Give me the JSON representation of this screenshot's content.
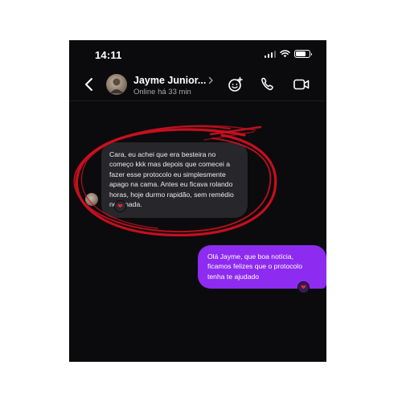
{
  "status_bar": {
    "time": "14:11",
    "icons": [
      "signal-icon",
      "wifi-icon",
      "battery-icon"
    ]
  },
  "header": {
    "back_icon": "chevron-left-icon",
    "contact_name": "Jayme Junior...",
    "presence": "Online há 33 min",
    "actions": [
      "add-sticker-icon",
      "phone-icon",
      "video-camera-icon"
    ]
  },
  "messages": [
    {
      "direction": "incoming",
      "text": "Cara, eu achei que era besteira no começo kkk mas depois que comecei a fazer esse protocolo eu simplesmente apago na cama. Antes eu ficava rolando horas, hoje durmo rapidão, sem remédio nem nada.",
      "reaction": "❤"
    },
    {
      "direction": "outgoing",
      "text": "Olá Jayme, que boa notícia, ficamos felizes que o protocolo tenha te ajudado",
      "reaction": "❤"
    }
  ],
  "colors": {
    "background": "#0b0b0d",
    "incoming_bubble": "#26262b",
    "outgoing_bubble": "#8e2bf0",
    "highlight_circle": "#d01020",
    "reaction_heart": "#e02a3a"
  }
}
